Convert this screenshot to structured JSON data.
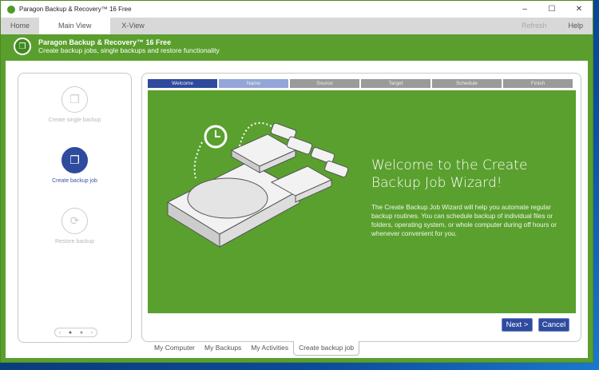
{
  "window": {
    "title": "Paragon Backup & Recovery™ 16 Free"
  },
  "menu": {
    "tabs": [
      "Home",
      "Main View",
      "X-View"
    ],
    "refresh": "Refresh",
    "help": "Help"
  },
  "header": {
    "title": "Paragon Backup & Recovery™ 16 Free",
    "subtitle": "Create backup jobs, single backups and restore functionality"
  },
  "sidebar": {
    "items": [
      {
        "label": "Create single backup"
      },
      {
        "label": "Create backup job"
      },
      {
        "label": "Restore backup"
      }
    ]
  },
  "wizard": {
    "steps": [
      "Welcome",
      "Name",
      "Source",
      "Target",
      "Schedule",
      "Finish"
    ],
    "title": "Welcome to the Create Backup Job Wizard!",
    "body": "The Create Backup Job Wizard will help you automate regular backup routines. You can schedule backup of individual files or folders, operating system, or whole computer during off hours or whenever convenient for you.",
    "next": "Next >",
    "cancel": "Cancel"
  },
  "bottom_tabs": [
    "My Computer",
    "My Backups",
    "My Activities",
    "Create backup job"
  ],
  "colors": {
    "green": "#5aa02e",
    "accent": "#2f4b9e"
  }
}
